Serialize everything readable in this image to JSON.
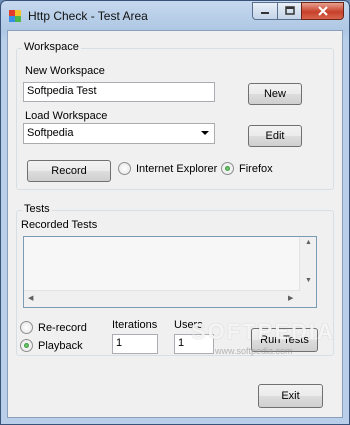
{
  "window": {
    "title": "Http Check - Test Area"
  },
  "workspace": {
    "group_label": "Workspace",
    "new_label": "New Workspace",
    "new_value": "Softpedia Test",
    "new_button": "New",
    "load_label": "Load Workspace",
    "load_value": "Softpedia",
    "edit_button": "Edit",
    "record_button": "Record",
    "browser_ie": "Internet Explorer",
    "browser_firefox": "Firefox",
    "selected_browser": "Firefox"
  },
  "tests": {
    "group_label": "Tests",
    "recorded_label": "Recorded Tests",
    "recorded_items": [],
    "mode_rerecord": "Re-record",
    "mode_playback": "Playback",
    "selected_mode": "Playback",
    "iterations_label": "Iterations",
    "iterations_value": "1",
    "users_label": "Users",
    "users_value": "1",
    "run_button": "Run Tests"
  },
  "footer": {
    "exit_button": "Exit"
  },
  "watermark": {
    "brand": "SOFTPEDIA",
    "url": "www.softpedia.com"
  },
  "colors": {
    "title_bar": "#b9cfe9",
    "close_button": "#c7412b",
    "client_bg": "#f0f0f0",
    "radio_on": "#1d6d1d"
  }
}
